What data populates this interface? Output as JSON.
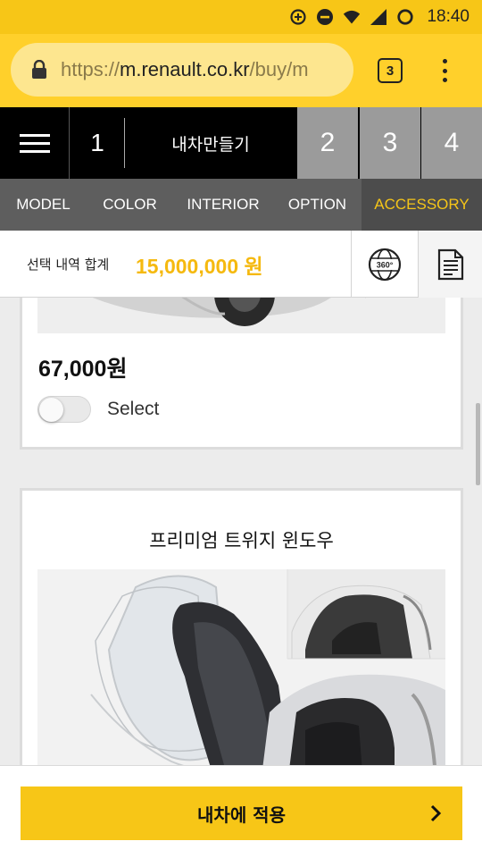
{
  "status_bar": {
    "time": "18:40",
    "icons": [
      "data-saver-icon",
      "do-not-disturb-icon",
      "wifi-icon",
      "signal-icon",
      "sync-icon"
    ]
  },
  "browser": {
    "url_scheme": "https://",
    "url_host": "m.renault.co.kr",
    "url_path": "/buy/m",
    "tab_count": "3"
  },
  "steps": {
    "current_number": "1",
    "current_label": "내차만들기",
    "others": [
      "2",
      "3",
      "4"
    ]
  },
  "categories": {
    "items": [
      "MODEL",
      "COLOR",
      "INTERIOR",
      "OPTION",
      "ACCESSORY"
    ],
    "active": "ACCESSORY"
  },
  "total": {
    "label": "선택 내역 합계",
    "value": "15,000,000 원",
    "view360_text": "360°"
  },
  "products": [
    {
      "price": "67,000원",
      "select_label": "Select",
      "selected": false
    },
    {
      "title": "프리미엄 트위지 윈도우"
    }
  ],
  "footer": {
    "apply_label": "내차에 적용"
  },
  "colors": {
    "brand_yellow": "#f7c617",
    "accent_text": "#f5b90f",
    "dark": "#000000",
    "step_inactive": "#9b9b9b",
    "tab_bar": "#5e5e5e"
  }
}
